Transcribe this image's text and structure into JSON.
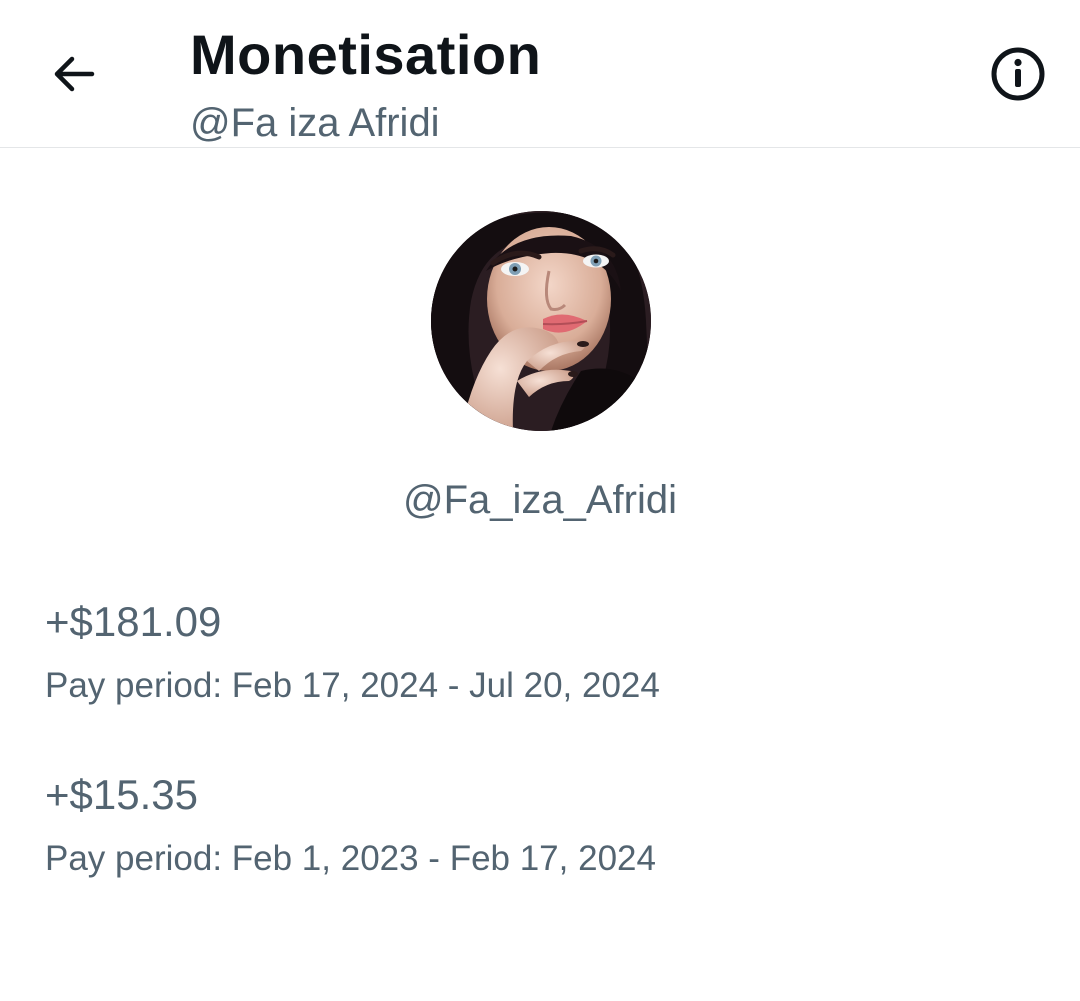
{
  "header": {
    "title": "Monetisation",
    "subtitle": "@Fa iza Afridi"
  },
  "icons": {
    "back": "arrow-left-icon",
    "info": "info-icon"
  },
  "profile": {
    "username": "@Fa_iza_Afridi"
  },
  "payouts": [
    {
      "amount": "+$181.09",
      "period": "Pay period: Feb 17, 2024 - Jul 20, 2024"
    },
    {
      "amount": "+$15.35",
      "period": "Pay period: Feb 1, 2023 - Feb 17, 2024"
    }
  ],
  "colors": {
    "primary_text": "#0f1419",
    "secondary_text": "#536471",
    "divider": "#e4e6e8"
  }
}
